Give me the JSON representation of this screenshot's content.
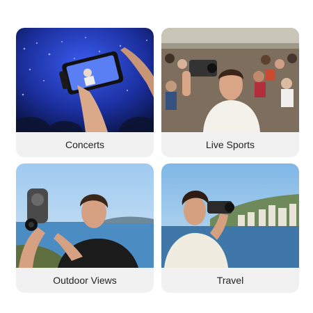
{
  "cards": [
    {
      "label": "Concerts",
      "scene": "concert-crowd-phone-icon"
    },
    {
      "label": "Live Sports",
      "scene": "stadium-crowd-phone-icon"
    },
    {
      "label": "Outdoor Views",
      "scene": "seaside-phone-lens-icon"
    },
    {
      "label": "Travel",
      "scene": "city-bay-phone-icon"
    }
  ],
  "colors": {
    "card_background": "#f1f1f1",
    "label_text": "#222222",
    "concert_blue": "#1b3ab8",
    "sky_blue": "#8fc3ea",
    "sea_blue": "#3f7fb3"
  }
}
